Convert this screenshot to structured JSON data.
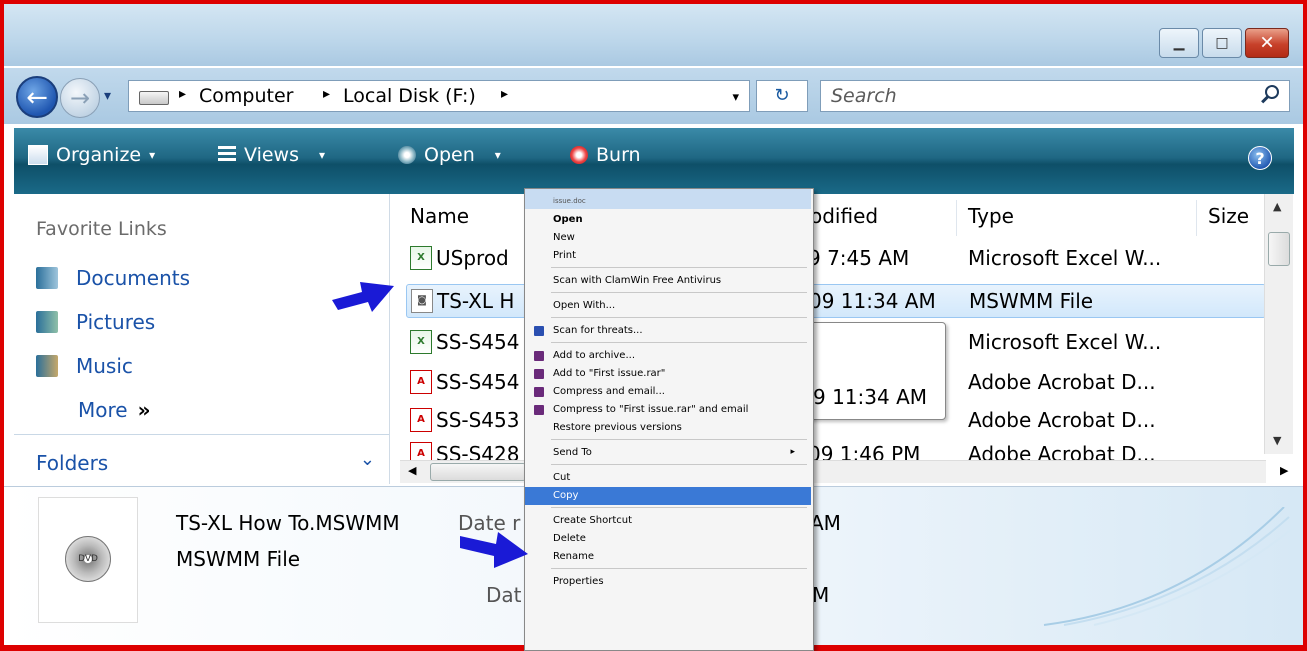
{
  "window": {
    "controls": {
      "minimize": "▁",
      "maximize": "□",
      "close": "✕"
    }
  },
  "nav": {
    "back_glyph": "←",
    "forward_glyph": "→",
    "history_glyph": "▾",
    "breadcrumbs": [
      "Computer",
      "Local Disk (F:)"
    ],
    "breadcrumb_sep": "▸",
    "dropdown_glyph": "▾",
    "refresh_glyph": "↻",
    "search_placeholder": "Search"
  },
  "toolbar": {
    "organize": "Organize",
    "views": "Views",
    "open": "Open",
    "burn": "Burn",
    "caret": "▾",
    "help": "?"
  },
  "sidebar": {
    "favorites_title": "Favorite Links",
    "links": [
      "Documents",
      "Pictures",
      "Music"
    ],
    "more": "More",
    "more_glyph": "»",
    "folders": "Folders",
    "folders_glyph": "⌄"
  },
  "columns": {
    "name": "Name",
    "modified": "odified",
    "type": "Type",
    "size": "Size"
  },
  "files": [
    {
      "icon": "excel",
      "name": "USprod",
      "date": "9 7:45 AM",
      "type": "Microsoft Excel W..."
    },
    {
      "icon": "wmm",
      "name": "TS-XL H",
      "date": "09 11:34 AM",
      "type": "MSWMM File"
    },
    {
      "icon": "excel",
      "name": "SS-S454",
      "date": "",
      "type": "Microsoft Excel W..."
    },
    {
      "icon": "pdf",
      "name": "SS-S454",
      "date": "",
      "type": "Adobe Acrobat D..."
    },
    {
      "icon": "pdf",
      "name": "SS-S453",
      "date": "",
      "type": "Adobe Acrobat D..."
    },
    {
      "icon": "pdf",
      "name": "SS-S428",
      "date": "09 1:46 PM",
      "type": "Adobe Acrobat D..."
    }
  ],
  "tooltip": {
    "text": "9 11:34 AM"
  },
  "details": {
    "filename": "TS-XL How To.MSWMM",
    "type": "MSWMM File",
    "date_label_partial": "Date r",
    "am_partial": "AM",
    "date_label_2": "Dat",
    "m_partial": "M",
    "icon_label": "DVD"
  },
  "context_menu": {
    "ghost_top": "issue.doc",
    "items": [
      {
        "label": "Open",
        "bold": true
      },
      {
        "label": "New"
      },
      {
        "label": "Print"
      },
      {
        "sep": true
      },
      {
        "label": "Scan with ClamWin Free Antivirus"
      },
      {
        "sep": true
      },
      {
        "label": "Open With..."
      },
      {
        "sep": true
      },
      {
        "label": "Scan for threats...",
        "icon": "#2a4fb0"
      },
      {
        "sep": true
      },
      {
        "label": "Add to archive...",
        "icon": "#6a2a7a"
      },
      {
        "label": "Add to \"First issue.rar\"",
        "icon": "#6a2a7a"
      },
      {
        "label": "Compress and email...",
        "icon": "#6a2a7a"
      },
      {
        "label": "Compress to \"First issue.rar\" and email",
        "icon": "#6a2a7a"
      },
      {
        "label": "Restore previous versions"
      },
      {
        "sep": true
      },
      {
        "label": "Send To",
        "submenu": "▸"
      },
      {
        "sep": true
      },
      {
        "label": "Cut"
      },
      {
        "label": "Copy",
        "highlight": true
      },
      {
        "sep": true
      },
      {
        "label": "Create Shortcut"
      },
      {
        "label": "Delete"
      },
      {
        "label": "Rename"
      },
      {
        "sep": true
      },
      {
        "label": "Properties"
      }
    ]
  },
  "colors": {
    "accent": "#1a52a8",
    "arrow": "#1a1ad6",
    "frame": "#dd0000"
  }
}
